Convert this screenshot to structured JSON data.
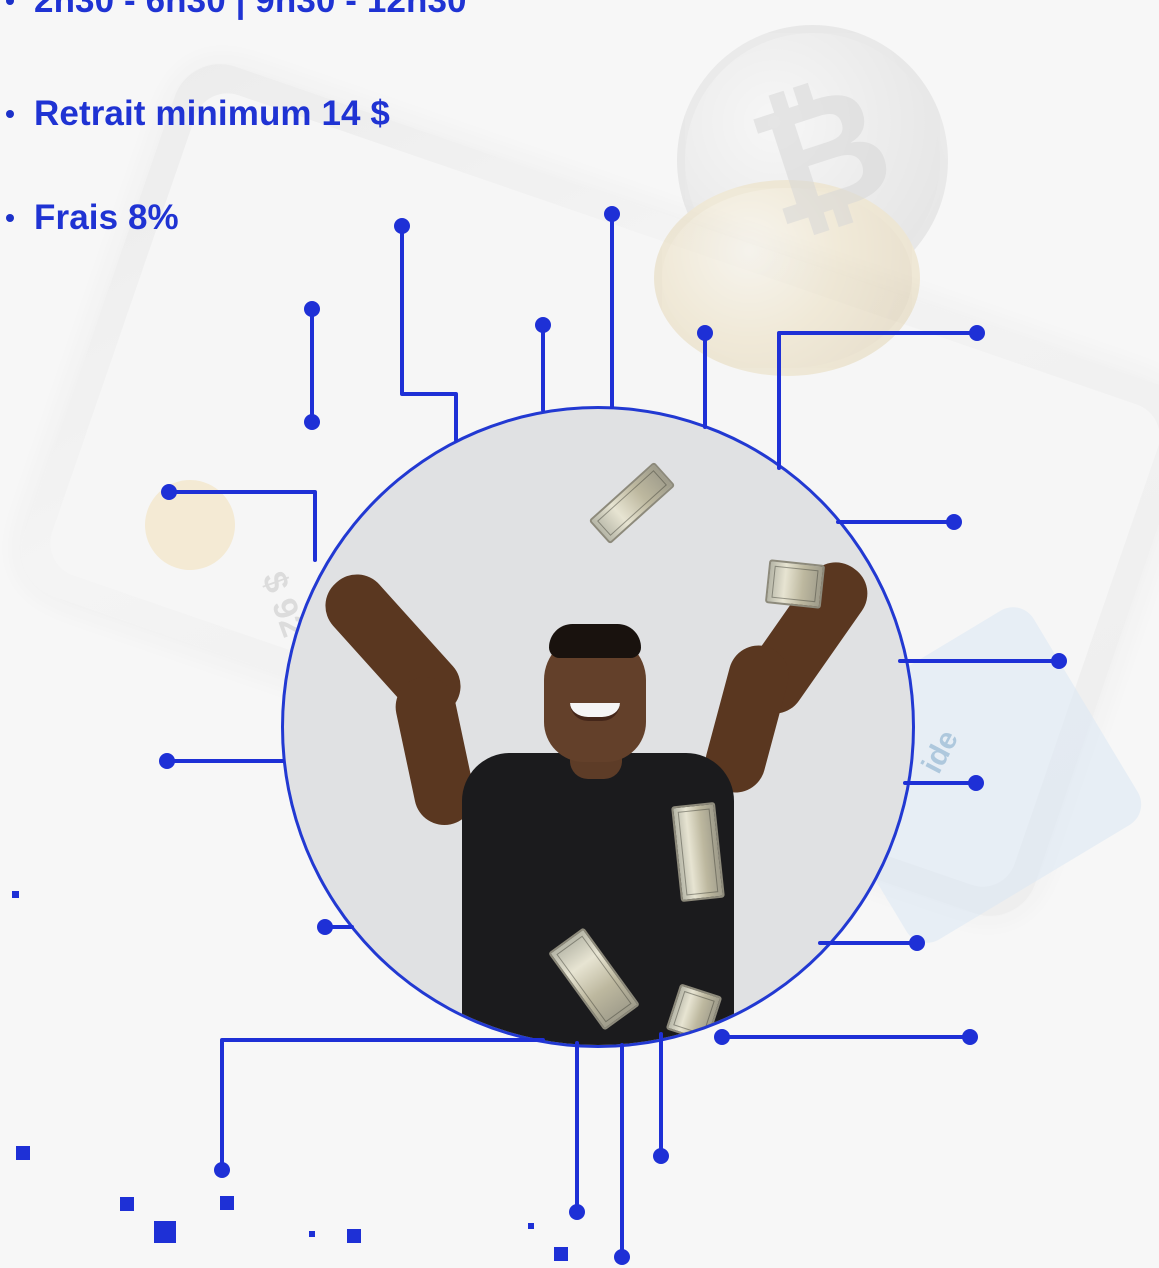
{
  "features": {
    "items": [
      {
        "label": "2h30 - 6h30 | 9h30 - 12h30"
      },
      {
        "label": "Retrait minimum 14 $"
      },
      {
        "label": "Frais 8%"
      }
    ]
  },
  "colors": {
    "accent": "#1f33d3",
    "circuit": "#1e30d6"
  },
  "icons": {
    "bitcoin": "bitcoin-icon",
    "money": "dollar-bill-icon"
  }
}
